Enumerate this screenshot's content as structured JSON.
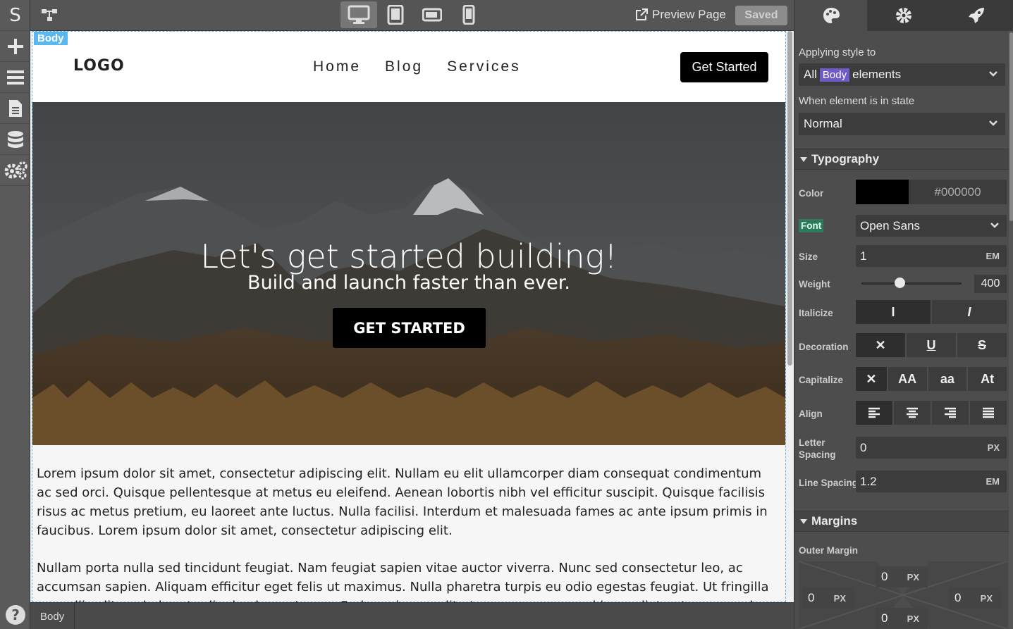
{
  "app": {
    "logo_letter": "S"
  },
  "rail": {
    "items": [
      {
        "icon": "add-icon"
      },
      {
        "icon": "layers-icon"
      },
      {
        "icon": "page-icon"
      },
      {
        "icon": "database-icon"
      },
      {
        "icon": "settings-gears-icon"
      }
    ],
    "help": "?"
  },
  "topbar": {
    "preview_label": "Preview Page",
    "saved_label": "Saved",
    "devices": [
      "desktop",
      "tablet",
      "tablet-landscape",
      "phone"
    ],
    "active_device": "desktop"
  },
  "canvas": {
    "body_tag": "Body",
    "site": {
      "logo": "LOGO",
      "nav": [
        "Home",
        "Blog",
        "Services"
      ],
      "cta": "Get Started"
    },
    "hero": {
      "title": "Let's get started building!",
      "subtitle": "Build and launch faster than ever.",
      "button": "GET STARTED"
    },
    "paragraphs": [
      "Lorem ipsum dolor sit amet, consectetur adipiscing elit. Nullam eu elit ullamcorper diam consequat condimentum ac sed orci. Quisque pellentesque at metus eu eleifend. Aenean lobortis nibh vel efficitur suscipit. Quisque facilisis risus ac metus pretium, eu laoreet ante luctus. Nulla facilisi. Interdum et malesuada fames ac ante ipsum primis in faucibus. Lorem ipsum dolor sit amet, consectetur adipiscing elit.",
      "Nullam porta nulla sed tincidunt feugiat. Nam feugiat sapien vitae auctor viverra. Nunc sed consectetur leo, ac accumsan sapien. Aliquam efficitur eget felis ut maximus. Nulla pharetra turpis eu odio egestas feugiat. Ut fringilla convallis elit, sed pharetra ligula elementum a. Sed maximus velit ut neque congue, vel imperdiet ante commodo."
    ]
  },
  "status": {
    "breadcrumb": "Body"
  },
  "panel": {
    "tabs": [
      "style",
      "settings",
      "publish"
    ],
    "applying_label": "Applying style to",
    "applying_prefix": "All",
    "applying_pill": "Body",
    "applying_suffix": "elements",
    "state_label": "When element is in state",
    "state_value": "Normal",
    "typography": {
      "header": "Typography",
      "color_label": "Color",
      "color_value": "#000000",
      "font_label": "Font",
      "font_value": "Open Sans",
      "size_label": "Size",
      "size_value": "1",
      "size_unit": "EM",
      "weight_label": "Weight",
      "weight_value": "400",
      "weight_fraction": 0.38,
      "italicize_label": "Italicize",
      "italicize_options": [
        "I",
        "I"
      ],
      "decoration_label": "Decoration",
      "decoration_options": [
        "✕",
        "U",
        "S"
      ],
      "capitalize_label": "Capitalize",
      "capitalize_options": [
        "✕",
        "AA",
        "aa",
        "At"
      ],
      "align_label": "Align",
      "letter_label_1": "Letter",
      "letter_label_2": "Spacing",
      "letter_value": "0",
      "letter_unit": "PX",
      "line_label": "Line Spacing",
      "line_value": "1.2",
      "line_unit": "EM"
    },
    "margins": {
      "header": "Margins",
      "outer_label": "Outer Margin",
      "top": "0",
      "left": "0",
      "right": "0",
      "bottom": "0",
      "unit": "PX"
    }
  }
}
